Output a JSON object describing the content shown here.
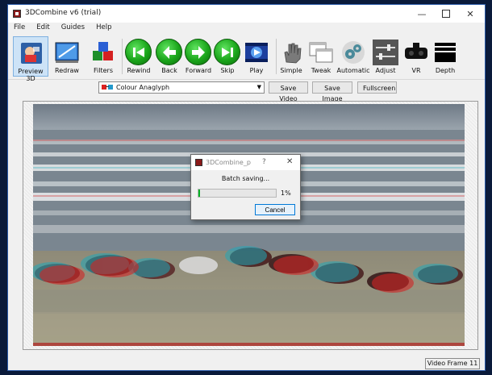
{
  "window": {
    "title": "3DCombine v6 (trial)"
  },
  "menu": [
    "File",
    "Edit",
    "Guides",
    "Help"
  ],
  "toolbar": {
    "preview": "Preview 3D",
    "redraw": "Redraw",
    "filters": "Filters",
    "rewind": "Rewind",
    "back": "Back",
    "forward": "Forward",
    "skip": "Skip",
    "play": "Play",
    "simple": "Simple",
    "tweak": "Tweak",
    "automatic": "Automatic",
    "adjust": "Adjust",
    "vr": "VR",
    "depth": "Depth"
  },
  "controls": {
    "mode_selected": "Colour Anaglyph",
    "save_video": "Save Video",
    "save_image": "Save Image",
    "fullscreen": "Fullscreen"
  },
  "dialog": {
    "title": "3DCombine_p",
    "help": "?",
    "message": "Batch saving...",
    "progress_fraction": 0.01,
    "progress_label": "1%",
    "cancel": "Cancel"
  },
  "status": {
    "frame": "Video Frame 11"
  }
}
